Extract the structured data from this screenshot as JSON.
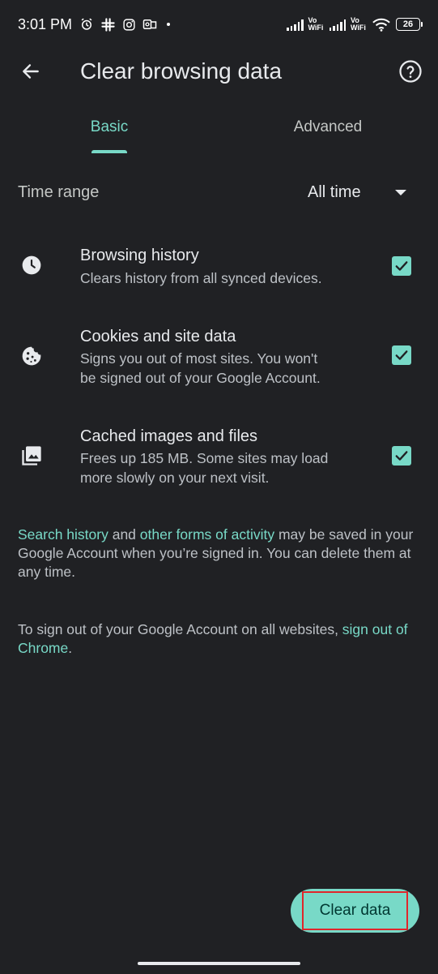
{
  "status_bar": {
    "time": "3:01 PM",
    "icons": [
      "alarm-icon",
      "slack-icon",
      "instagram-icon",
      "outlook-icon",
      "dot"
    ],
    "vowifi_1": "Vo WiFi",
    "vowifi_2": "Vo WiFi",
    "battery": "26"
  },
  "header": {
    "title": "Clear browsing data",
    "back_icon": "arrow-back-icon",
    "help_icon": "help-circle-icon"
  },
  "tabs": [
    {
      "label": "Basic",
      "selected": true
    },
    {
      "label": "Advanced",
      "selected": false
    }
  ],
  "time_range": {
    "label": "Time range",
    "value": "All time"
  },
  "options": [
    {
      "icon": "clock-icon",
      "title": "Browsing history",
      "desc1": "Clears history from all synced devices.",
      "desc2": "",
      "checked": true
    },
    {
      "icon": "cookie-icon",
      "title": "Cookies and site data",
      "desc1": "Signs you out of most sites. You won't",
      "desc2": "be signed out of your Google Account.",
      "checked": true
    },
    {
      "icon": "image-gallery-icon",
      "title": "Cached images and files",
      "desc1": "Frees up 185 MB. Some sites may load",
      "desc2": "more slowly on your next visit.",
      "checked": true
    }
  ],
  "info1": {
    "link1": "Search history",
    "and": " and ",
    "link2": "other forms of activity",
    "rest": " may be saved in your Google Account when you’re signed in. You can delete them at any time."
  },
  "info2": {
    "text": "To sign out of your Google Account on all websites, ",
    "link": "sign out of Chrome",
    "end": "."
  },
  "clear_button": "Clear data",
  "colors": {
    "background": "#202124",
    "accent": "#78d9c7",
    "highlight": "#e0262b"
  }
}
